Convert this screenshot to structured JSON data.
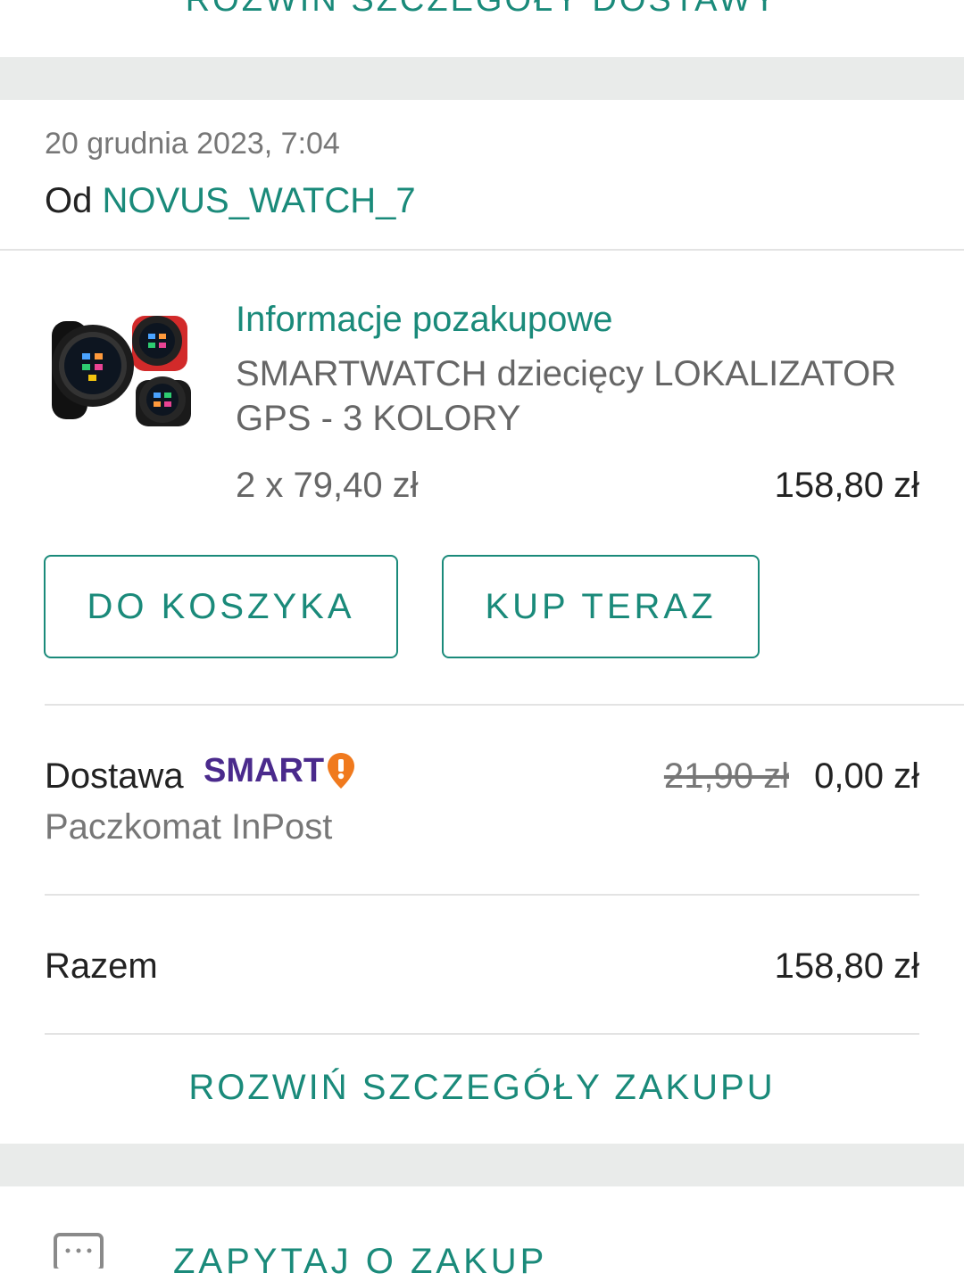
{
  "delivery_section": {
    "expand_link": "ROZWIŃ SZCZEGÓŁY DOSTAWY"
  },
  "order": {
    "date": "20 grudnia 2023, 7:04",
    "seller_prefix": "Od",
    "seller_name": "NOVUS_WATCH_7"
  },
  "item": {
    "info_title": "Informacje pozakupowe",
    "name": "SMARTWATCH dziecięcy LOKALIZATOR GPS - 3 KOLORY",
    "quantity_price": "2 x 79,40 zł",
    "line_total": "158,80 zł",
    "thumbnail_icon": "smartwatch-product-image"
  },
  "actions": {
    "add_to_cart": "DO KOSZYKA",
    "buy_now": "KUP TERAZ"
  },
  "delivery": {
    "label": "Dostawa",
    "smart_badge": "SMART",
    "method": "Paczkomat InPost",
    "old_price": "21,90 zł",
    "price": "0,00 zł"
  },
  "summary": {
    "total_label": "Razem",
    "total_value": "158,80 zł",
    "expand_link": "ROZWIŃ SZCZEGÓŁY ZAKUPU"
  },
  "ask": {
    "label": "ZAPYTAJ O ZAKUP",
    "icon": "chat-icon"
  },
  "colors": {
    "accent": "#1a8a7a",
    "smart_brand": "#4a2a8c",
    "smart_pin": "#f07a1e",
    "separator_band": "#e9ebea"
  }
}
